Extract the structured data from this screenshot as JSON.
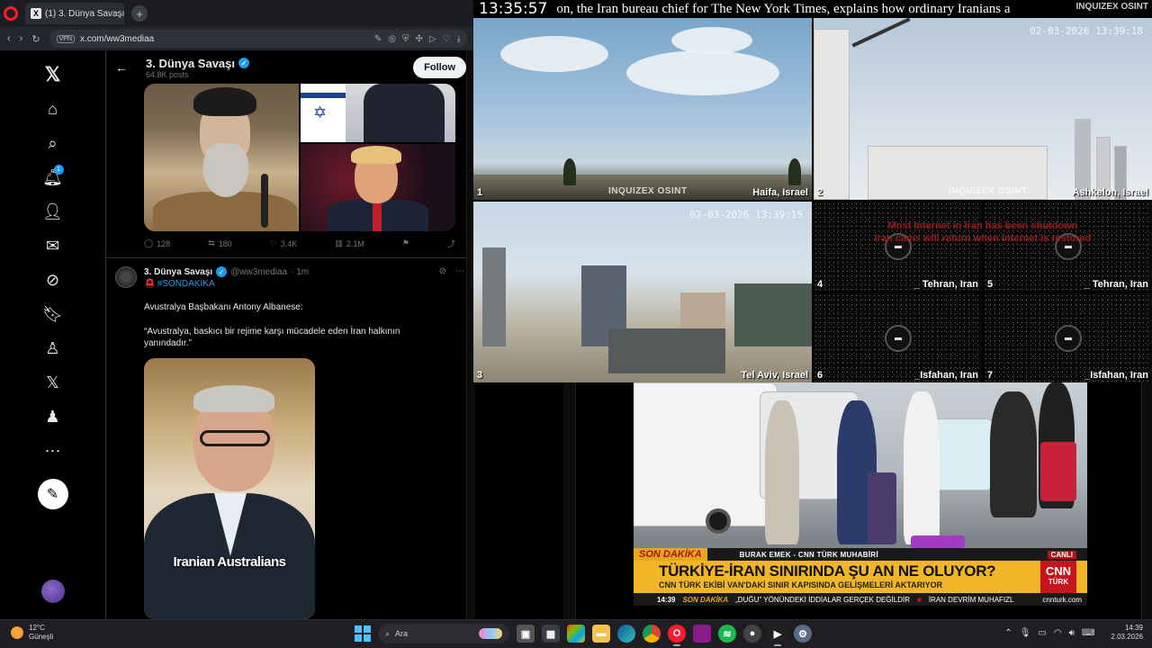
{
  "browser": {
    "tab_title": "(1) 3. Dünya Savaşı (@ww",
    "tab_new": "+",
    "url": "x.com/ww3mediaa",
    "vpn_label": "VPN"
  },
  "x_profile": {
    "name": "3. Dünya Savaşı",
    "posts_count": "64.8K posts",
    "follow_label": "Follow",
    "notification_count": "1"
  },
  "post1": {
    "replies": "128",
    "reposts": "180",
    "likes": "3.4K",
    "views": "2.1M"
  },
  "post2": {
    "author": "3. Dünya Savaşı",
    "handle": "@ww3mediaa",
    "time": "· 1m",
    "hashtag": "#SONDAKİKA",
    "line1": "Avustralya Başbakanı Antony Albanese:",
    "quote": "“Avustralya, baskıcı bir rejime karşı mücadele eden İran halkının yanındadır.”",
    "video_caption": "Iranian Australians"
  },
  "stream": {
    "clock": "13:35:57",
    "ticker_text": "on, the Iran bureau chief for The New York Times, explains how ordinary Iranians a",
    "brand": "INQUIZEX OSINT",
    "watermark": "INQUIZEX OSINT",
    "internet_msg_line1": "Most Internet in Iran has been shutdown",
    "internet_msg_line2": "Iran cams will return when internet is restored",
    "cams": [
      {
        "num": "1",
        "loc": "Haifa, Israel",
        "ts": ""
      },
      {
        "num": "2",
        "loc": "Ashkelon, Israel",
        "ts": "02-03-2026 13:39:18"
      },
      {
        "num": "3",
        "loc": "Tel Aviv, Israel",
        "ts": "02-03-2026 13:39:15"
      },
      {
        "num": "4",
        "loc": "_ Tehran, Iran"
      },
      {
        "num": "5",
        "loc": "_ Tehran, Iran"
      },
      {
        "num": "6",
        "loc": "_Isfahan, Iran"
      },
      {
        "num": "7",
        "loc": "_Isfahan, Iran"
      }
    ]
  },
  "news": {
    "son_dakika": "SON DAKİKA",
    "reporter": "BURAK EMEK - CNN TÜRK MUHABİRİ",
    "live": "CANLI",
    "headline": "TÜRKİYE-İRAN SINIRINDA ŞU AN NE OLUYOR?",
    "subheadline": "CNN TÜRK EKİBİ VAN'DAKİ SINIR KAPISINDA GELİŞMELERİ AKTARIYOR",
    "logo_top": "CNN",
    "logo_bottom": "TÜRK",
    "bottom_time": "14:39",
    "bottom_son": "SON DAKİKA",
    "bottom_item1": "„DUĞU\" YÖNÜNDEKİ İDDİALAR GERÇEK DEĞİLDİR",
    "bottom_item2": "İRAN DEVRİM MUHAFIZL",
    "bottom_site": "cnnturk.com"
  },
  "taskbar": {
    "temp": "12°C",
    "condition": "Güneşli",
    "search_placeholder": "Ara",
    "time": "14:39",
    "date": "2.03.2026"
  },
  "colors": {
    "x_blue": "#1d9bf0",
    "cnn_red": "#c8121d",
    "cnn_yellow": "#f0b628",
    "opera_red": "#ff1b2d"
  }
}
